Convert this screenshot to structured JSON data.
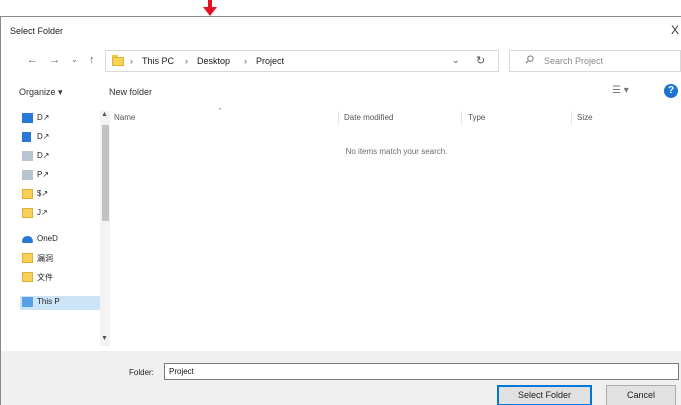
{
  "dialog": {
    "title": "Select Folder",
    "close_glyph": "X"
  },
  "nav": {
    "back_glyph": "←",
    "forward_glyph": "→",
    "recent_glyph": "⌄",
    "up_glyph": "↑",
    "breadcrumb": [
      "This PC",
      "Desktop",
      "Project"
    ],
    "crumb_separator": "›",
    "dropdown_glyph": "⌄",
    "refresh_glyph": "↻",
    "search_placeholder": "Search Project",
    "search_icon": "search-icon"
  },
  "toolbar": {
    "organize_label": "Organize ▾",
    "new_folder_label": "New folder",
    "view_glyph": "☰ ▾",
    "help_glyph": "?"
  },
  "sidebar": {
    "items": [
      {
        "label": "D↗",
        "icon": "desktop-icon"
      },
      {
        "label": "D↗",
        "icon": "downloads-icon"
      },
      {
        "label": "D↗",
        "icon": "documents-icon"
      },
      {
        "label": "P↗",
        "icon": "pictures-icon"
      },
      {
        "label": "$↗",
        "icon": "folder-icon"
      },
      {
        "label": "J↗",
        "icon": "folder-icon"
      },
      {
        "label": "OneD",
        "icon": "onedrive-icon"
      },
      {
        "label": "漏洞",
        "icon": "folder-icon"
      },
      {
        "label": "文件",
        "icon": "folder-icon"
      },
      {
        "label": "This P",
        "icon": "pc-icon",
        "selected": true
      }
    ]
  },
  "file_list": {
    "columns": [
      "Name",
      "Date modified",
      "Type",
      "Size"
    ],
    "empty_message": "No items match your search."
  },
  "footer": {
    "folder_label": "Folder:",
    "folder_value": "Project",
    "select_button": "Select Folder",
    "cancel_button": "Cancel"
  },
  "colors": {
    "accent": "#0078d7",
    "annotation_arrow": "#e81123",
    "help": "#1e73d2"
  }
}
